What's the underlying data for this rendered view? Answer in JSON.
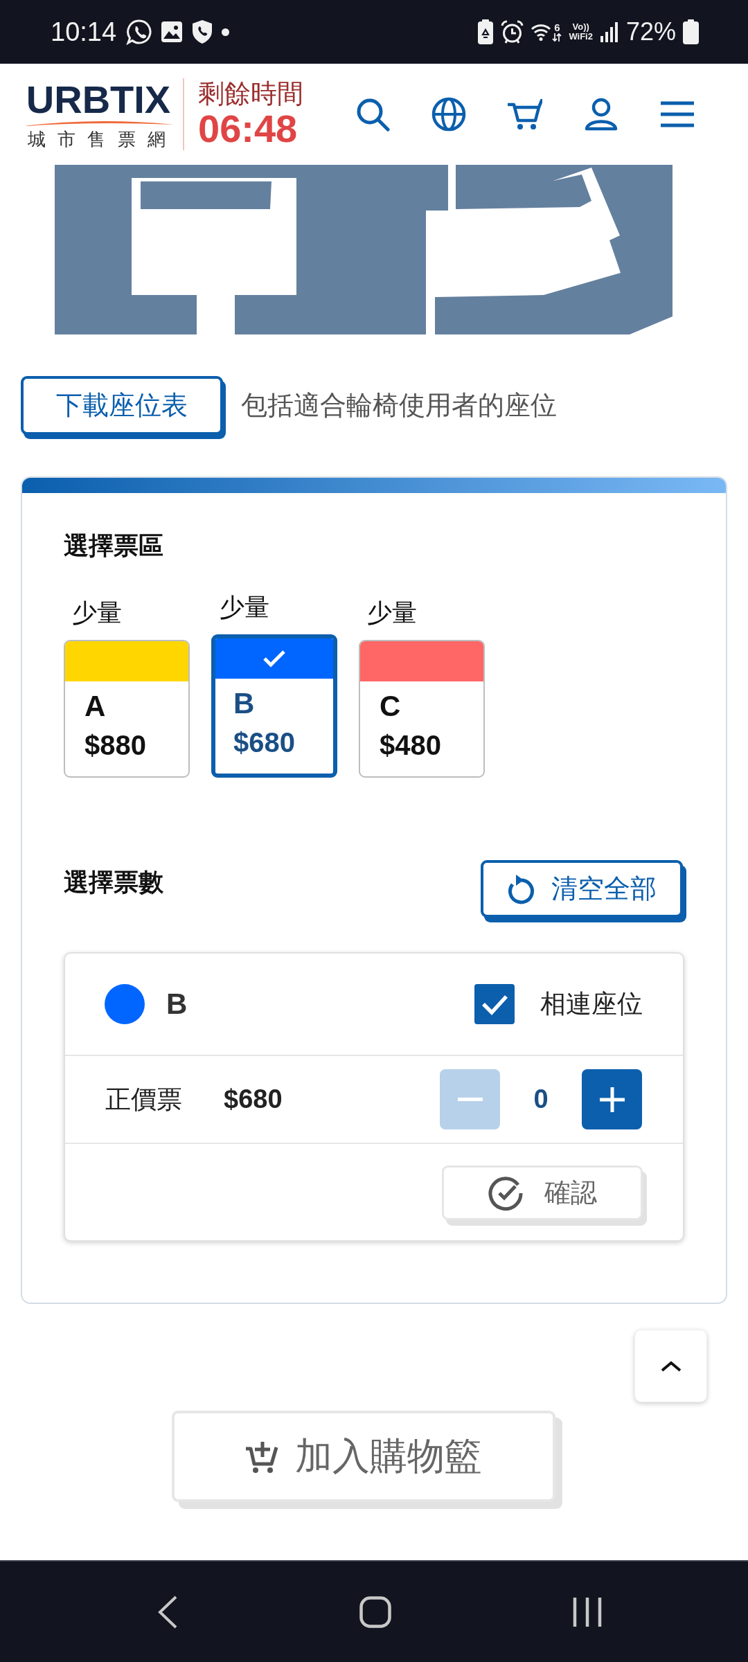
{
  "status_bar": {
    "time": "10:14",
    "wifi_badge": "6",
    "vowifi": [
      "Vo))",
      "WiFi2"
    ],
    "battery": "72%"
  },
  "header": {
    "logo": {
      "wordmark": "URBTIX",
      "subtitle": "城 市 售 票 網"
    },
    "timer": {
      "label": "剩餘時間",
      "value": "06:48"
    }
  },
  "seat_map": {
    "download_button": "下載座位表",
    "note": "包括適合輪椅使用者的座位"
  },
  "zone_section": {
    "title": "選擇票區",
    "zones": [
      {
        "availability": "少量",
        "name": "A",
        "price": "$880",
        "color": "#ffd600",
        "selected": false
      },
      {
        "availability": "少量",
        "name": "B",
        "price": "$680",
        "color": "#0066ff",
        "selected": true
      },
      {
        "availability": "少量",
        "name": "C",
        "price": "$480",
        "color": "#ff6666",
        "selected": false
      }
    ]
  },
  "quantity_section": {
    "title": "選擇票數",
    "clear_button": "清空全部",
    "panel": {
      "zone": "B",
      "color": "#0066ff",
      "adjacent_seats": {
        "label": "相連座位",
        "checked": true
      },
      "tickets": [
        {
          "type": "正價票",
          "price": "$680",
          "count": "0",
          "decrease_disabled": true
        }
      ],
      "confirm_button": "確認"
    }
  },
  "add_to_cart_button": "加入購物籃"
}
